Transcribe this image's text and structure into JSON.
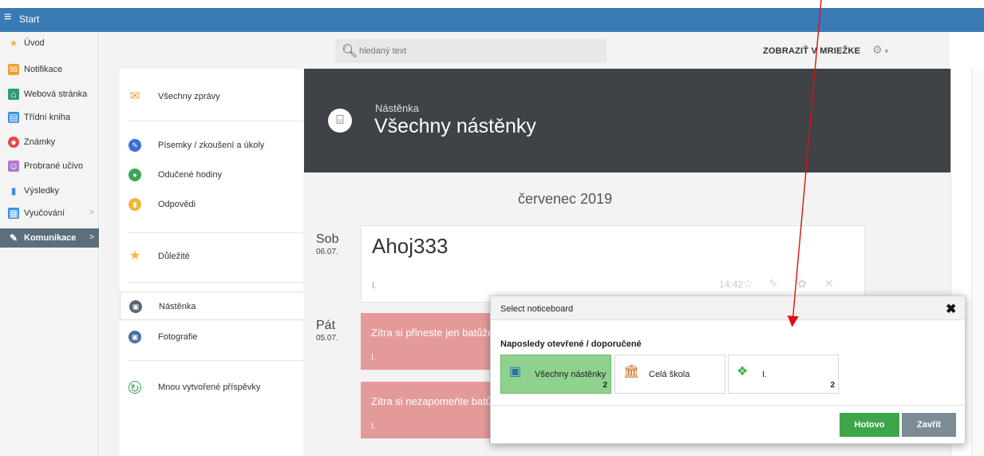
{
  "topbar": {
    "menu_glyph": "≡",
    "title": "Start"
  },
  "sidebar": {
    "items": [
      {
        "label": "Úvod",
        "icon": "star-icon",
        "glyph": "★",
        "color": "#f2b53a"
      },
      {
        "label": "Notifikace",
        "icon": "envelope-icon",
        "glyph": "✉",
        "color": "#f0a030"
      },
      {
        "label": "Webová stránka",
        "icon": "house-icon",
        "glyph": "⌂",
        "color": "#2c9c6a"
      },
      {
        "label": "Třídní kniha",
        "icon": "book-icon",
        "glyph": "▤",
        "color": "#3b8fe0"
      },
      {
        "label": "Známky",
        "icon": "grade-icon",
        "glyph": "●",
        "color": "#e04b4b"
      },
      {
        "label": "Probrané učivo",
        "icon": "people-icon",
        "glyph": "☺",
        "color": "#b07ad0"
      },
      {
        "label": "Výsledky",
        "icon": "bar-chart-icon",
        "glyph": "▮",
        "color": "#3b8fe0"
      },
      {
        "label": "Vyučování",
        "icon": "classroom-icon",
        "glyph": "▦",
        "color": "#3b8fe0"
      },
      {
        "label": "Komunikace",
        "icon": "chat-icon",
        "glyph": "✎",
        "color": "#ffffff"
      }
    ],
    "chevron": ">"
  },
  "search": {
    "placeholder": "hledaný text"
  },
  "toolbar": {
    "grid_label": "ZOBRAZIŤ V MRIEŽKE",
    "gear_glyph": "⚙",
    "caret": "▾"
  },
  "submenu": {
    "items": [
      {
        "label": "Všechny zprávy",
        "icon": "envelope-icon",
        "glyph": "✉",
        "color": "#f0a030"
      },
      {
        "label": "Písemky / zkoušení a úkoly",
        "icon": "task-icon",
        "glyph": "✎",
        "color": "#3b6fd6"
      },
      {
        "label": "Odučené hodiny",
        "icon": "lesson-icon",
        "glyph": "●",
        "color": "#3aa657"
      },
      {
        "label": "Odpovědi",
        "icon": "answers-icon",
        "glyph": "▮",
        "color": "#f2b53a"
      },
      {
        "label": "Důležité",
        "icon": "star-icon",
        "glyph": "★",
        "color": "#f2b53a"
      },
      {
        "label": "Nástěnka",
        "icon": "noticeboard-icon",
        "glyph": "▣",
        "color": "#5a6570"
      },
      {
        "label": "Fotografie",
        "icon": "photo-icon",
        "glyph": "▣",
        "color": "#4a6f9e"
      },
      {
        "label": "Mnou vytvořené příspěvky",
        "icon": "refresh-icon",
        "glyph": "↻",
        "color": "#3aa657"
      }
    ]
  },
  "header": {
    "crumb": "Nástěnka",
    "title": "Všechny nástěnky",
    "icon_glyph": "⌸"
  },
  "feed": {
    "month": "červenec 2019",
    "days": [
      {
        "name": "Sob",
        "date": "06.07."
      },
      {
        "name": "Pát",
        "date": "05.07."
      }
    ],
    "posts": [
      {
        "title": "Ahoj333",
        "class": "I.",
        "time": "14:42"
      },
      {
        "title": "Zítra si přineste jen batůže",
        "class": "I."
      },
      {
        "title": "Zítra si nezapomeňte batů",
        "class": "I."
      }
    ],
    "actions": {
      "star": "☆",
      "edit": "✎",
      "palette": "✿",
      "delete": "✕"
    }
  },
  "modal": {
    "title": "Select noticeboard",
    "close_glyph": "✖",
    "section": "Naposledy otevřené / doporučené",
    "options": [
      {
        "label": "Všechny nástěnky",
        "count": "2",
        "icon": "picture-icon",
        "glyph": "▣",
        "color": "#2f6fb0",
        "selected": true
      },
      {
        "label": "Celá škola",
        "count": "",
        "icon": "school-icon",
        "glyph": "🏛",
        "color": "#c6661a",
        "selected": false
      },
      {
        "label": "I.",
        "count": "2",
        "icon": "group-icon",
        "glyph": "❖",
        "color": "#3fb04a",
        "selected": false
      }
    ],
    "ok_label": "Hotovo",
    "close_label": "Zavřít"
  },
  "colors": {
    "topbar": "#3b7bb5",
    "header": "#3f4247",
    "post_red": "#e59a9a",
    "ok": "#3da54b",
    "annotation": "#e01010"
  }
}
